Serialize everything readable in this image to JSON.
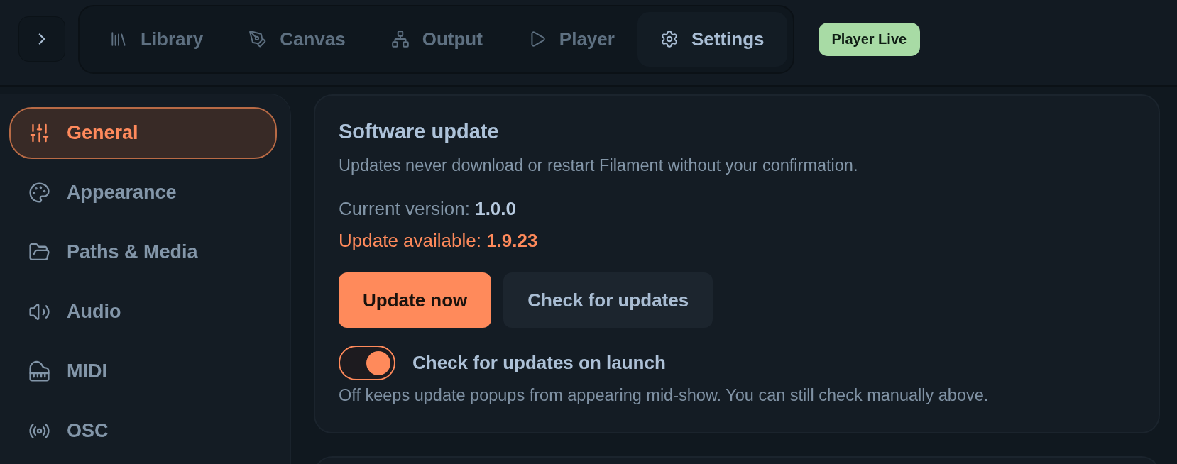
{
  "header": {
    "tabs": [
      {
        "label": "Library",
        "selected": false
      },
      {
        "label": "Canvas",
        "selected": false
      },
      {
        "label": "Output",
        "selected": false
      },
      {
        "label": "Player",
        "selected": false
      },
      {
        "label": "Settings",
        "selected": true
      }
    ],
    "status_badge": {
      "label": "Player Live"
    }
  },
  "sidebar": {
    "items": [
      {
        "label": "General",
        "selected": true
      },
      {
        "label": "Appearance",
        "selected": false
      },
      {
        "label": "Paths & Media",
        "selected": false
      },
      {
        "label": "Audio",
        "selected": false
      },
      {
        "label": "MIDI",
        "selected": false
      },
      {
        "label": "OSC",
        "selected": false
      }
    ]
  },
  "sections": [
    {
      "title": "Software update",
      "description": "Updates never download or restart Filament without your confirmation.",
      "version_lines": [
        {
          "kind": "current",
          "text": "Current version: **1.0.0**"
        },
        {
          "kind": "available",
          "text": "Update available: **1.9.23**"
        }
      ],
      "buttons": [
        {
          "kind": "primary",
          "label": "Update now"
        },
        {
          "kind": "secondary",
          "label": "Check for updates"
        }
      ],
      "toggle": {
        "label": "Check for updates on launch",
        "on": true
      },
      "note": "Off keeps update popups from appearing mid-show. You can still check manually above."
    }
  ]
}
